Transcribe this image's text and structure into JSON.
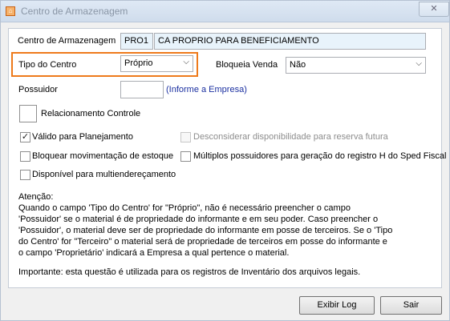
{
  "window": {
    "title": "Centro de Armazenagem",
    "close": "✕"
  },
  "form": {
    "centro_label": "Centro de Armazenagem",
    "centro_code": "PRO1",
    "centro_desc": "CA PROPRIO PARA BENEFICIAMENTO",
    "tipo_label": "Tipo do Centro",
    "tipo_value": "Próprio",
    "bloqueia_label": "Bloqueia Venda",
    "bloqueia_value": "Não",
    "possuidor_label": "Possuidor",
    "possuidor_value": "",
    "possuidor_hint": "(Informe a Empresa)",
    "relacionamento_label": "Relacionamento Controle"
  },
  "checkboxes": [
    {
      "label": "Válido para Planejamento",
      "checked": true,
      "enabled": true
    },
    {
      "label": "Desconsiderar disponibilidade para reserva futura",
      "checked": false,
      "enabled": false
    },
    {
      "label": "Bloquear movimentação de estoque",
      "checked": false,
      "enabled": true
    },
    {
      "label": "Múltiplos possuidores para geração do registro H do Sped Fiscal",
      "checked": false,
      "enabled": true
    },
    {
      "label": "Disponível para multiendereçamento",
      "checked": false,
      "enabled": true
    }
  ],
  "notes": {
    "line1": "Atenção:",
    "line2": "Quando o campo 'Tipo do Centro' for \"Próprio\", não é necessário preencher o campo",
    "line3": "'Possuidor' se o material é de propriedade do informante e em seu poder. Caso preencher o",
    "line4": "'Possuidor', o material deve ser de propriedade do informante em posse de terceiros. Se o 'Tipo",
    "line5": "do Centro' for \"Terceiro\" o material será de propriedade de terceiros em posse do informante e",
    "line6": "o campo 'Proprietário' indicará a Empresa a qual pertence o material.",
    "line7": "Importante: esta questão é utilizada para os registros de Inventário dos arquivos legais."
  },
  "buttons": {
    "log": "Exibir Log",
    "exit": "Sair"
  }
}
